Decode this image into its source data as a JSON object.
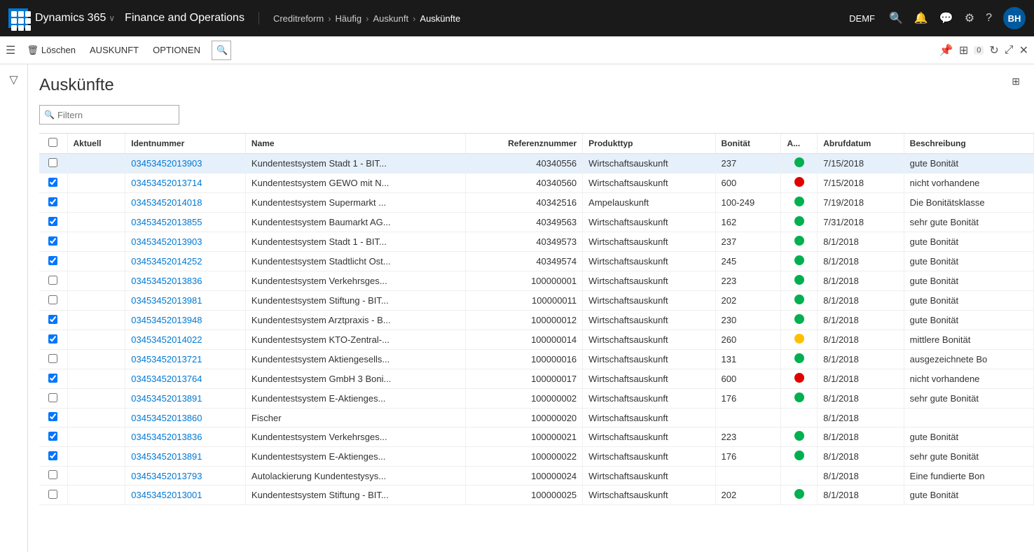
{
  "topnav": {
    "dynamics_label": "Dynamics 365",
    "module_label": "Finance and Operations",
    "chevron": "∨",
    "breadcrumbs": [
      "Creditreform",
      "Häufig",
      "Auskunft",
      "Auskünfte"
    ],
    "environment": "DEMF",
    "avatar_label": "BH"
  },
  "toolbar": {
    "delete_label": "Löschen",
    "menu1_label": "AUSKUNFT",
    "menu2_label": "OPTIONEN"
  },
  "page": {
    "title": "Auskünfte",
    "filter_placeholder": "Filtern"
  },
  "table": {
    "columns": [
      "Aktuell",
      "Identnummer",
      "Name",
      "Referenznummer",
      "Produkttyp",
      "Bonität",
      "A...",
      "Abrufdatum",
      "Beschreibung"
    ],
    "rows": [
      {
        "checked": false,
        "selected": true,
        "id": "03453452013903",
        "name": "Kundentestsystem Stadt 1 - BIT...",
        "ref": "40340556",
        "product": "Wirtschaftsauskunft",
        "bonitaet": "237",
        "ampel": "green",
        "date": "7/15/2018",
        "desc": "gute Bonität"
      },
      {
        "checked": true,
        "selected": false,
        "id": "03453452013714",
        "name": "Kundentestsystem GEWO mit N...",
        "ref": "40340560",
        "product": "Wirtschaftsauskunft",
        "bonitaet": "600",
        "ampel": "red",
        "date": "7/15/2018",
        "desc": "nicht vorhandene"
      },
      {
        "checked": true,
        "selected": false,
        "id": "03453452014018",
        "name": "Kundentestsystem Supermarkt ...",
        "ref": "40342516",
        "product": "Ampelauskunft",
        "bonitaet": "100-249",
        "ampel": "green",
        "date": "7/19/2018",
        "desc": "Die Bonitätsklasse"
      },
      {
        "checked": true,
        "selected": false,
        "id": "03453452013855",
        "name": "Kundentestsystem Baumarkt AG...",
        "ref": "40349563",
        "product": "Wirtschaftsauskunft",
        "bonitaet": "162",
        "ampel": "green",
        "date": "7/31/2018",
        "desc": "sehr gute Bonität"
      },
      {
        "checked": true,
        "selected": false,
        "id": "03453452013903",
        "name": "Kundentestsystem Stadt 1 - BIT...",
        "ref": "40349573",
        "product": "Wirtschaftsauskunft",
        "bonitaet": "237",
        "ampel": "green",
        "date": "8/1/2018",
        "desc": "gute Bonität"
      },
      {
        "checked": true,
        "selected": false,
        "id": "03453452014252",
        "name": "Kundentestsystem Stadtlicht Ost...",
        "ref": "40349574",
        "product": "Wirtschaftsauskunft",
        "bonitaet": "245",
        "ampel": "green",
        "date": "8/1/2018",
        "desc": "gute Bonität"
      },
      {
        "checked": false,
        "selected": false,
        "id": "03453452013836",
        "name": "Kundentestsystem Verkehrsges...",
        "ref": "100000001",
        "product": "Wirtschaftsauskunft",
        "bonitaet": "223",
        "ampel": "green",
        "date": "8/1/2018",
        "desc": "gute Bonität"
      },
      {
        "checked": false,
        "selected": false,
        "id": "03453452013981",
        "name": "Kundentestsystem Stiftung - BIT...",
        "ref": "100000011",
        "product": "Wirtschaftsauskunft",
        "bonitaet": "202",
        "ampel": "green",
        "date": "8/1/2018",
        "desc": "gute Bonität"
      },
      {
        "checked": true,
        "selected": false,
        "id": "03453452013948",
        "name": "Kundentestsystem Arztpraxis - B...",
        "ref": "100000012",
        "product": "Wirtschaftsauskunft",
        "bonitaet": "230",
        "ampel": "green",
        "date": "8/1/2018",
        "desc": "gute Bonität"
      },
      {
        "checked": true,
        "selected": false,
        "id": "03453452014022",
        "name": "Kundentestsystem KTO-Zentral-...",
        "ref": "100000014",
        "product": "Wirtschaftsauskunft",
        "bonitaet": "260",
        "ampel": "yellow",
        "date": "8/1/2018",
        "desc": "mittlere Bonität"
      },
      {
        "checked": false,
        "selected": false,
        "id": "03453452013721",
        "name": "Kundentestsystem Aktiengesells...",
        "ref": "100000016",
        "product": "Wirtschaftsauskunft",
        "bonitaet": "131",
        "ampel": "green",
        "date": "8/1/2018",
        "desc": "ausgezeichnete Bo"
      },
      {
        "checked": true,
        "selected": false,
        "id": "03453452013764",
        "name": "Kundentestsystem GmbH 3 Boni...",
        "ref": "100000017",
        "product": "Wirtschaftsauskunft",
        "bonitaet": "600",
        "ampel": "red",
        "date": "8/1/2018",
        "desc": "nicht vorhandene"
      },
      {
        "checked": false,
        "selected": false,
        "id": "03453452013891",
        "name": "Kundentestsystem E-Aktienges...",
        "ref": "100000002",
        "product": "Wirtschaftsauskunft",
        "bonitaet": "176",
        "ampel": "green",
        "date": "8/1/2018",
        "desc": "sehr gute Bonität"
      },
      {
        "checked": true,
        "selected": false,
        "id": "03453452013860",
        "name": "Fischer",
        "ref": "100000020",
        "product": "Wirtschaftsauskunft",
        "bonitaet": "",
        "ampel": "",
        "date": "8/1/2018",
        "desc": ""
      },
      {
        "checked": true,
        "selected": false,
        "id": "03453452013836",
        "name": "Kundentestsystem Verkehrsges...",
        "ref": "100000021",
        "product": "Wirtschaftsauskunft",
        "bonitaet": "223",
        "ampel": "green",
        "date": "8/1/2018",
        "desc": "gute Bonität"
      },
      {
        "checked": true,
        "selected": false,
        "id": "03453452013891",
        "name": "Kundentestsystem E-Aktienges...",
        "ref": "100000022",
        "product": "Wirtschaftsauskunft",
        "bonitaet": "176",
        "ampel": "green",
        "date": "8/1/2018",
        "desc": "sehr gute Bonität"
      },
      {
        "checked": false,
        "selected": false,
        "id": "03453452013793",
        "name": "Autolackierung Kundentestysys...",
        "ref": "100000024",
        "product": "Wirtschaftsauskunft",
        "bonitaet": "",
        "ampel": "",
        "date": "8/1/2018",
        "desc": "Eine fundierte Bon"
      },
      {
        "checked": false,
        "selected": false,
        "id": "03453452013001",
        "name": "Kundentestsystem Stiftung - BIT...",
        "ref": "100000025",
        "product": "Wirtschaftsauskunft",
        "bonitaet": "202",
        "ampel": "green",
        "date": "8/1/2018",
        "desc": "gute Bonität"
      }
    ]
  }
}
